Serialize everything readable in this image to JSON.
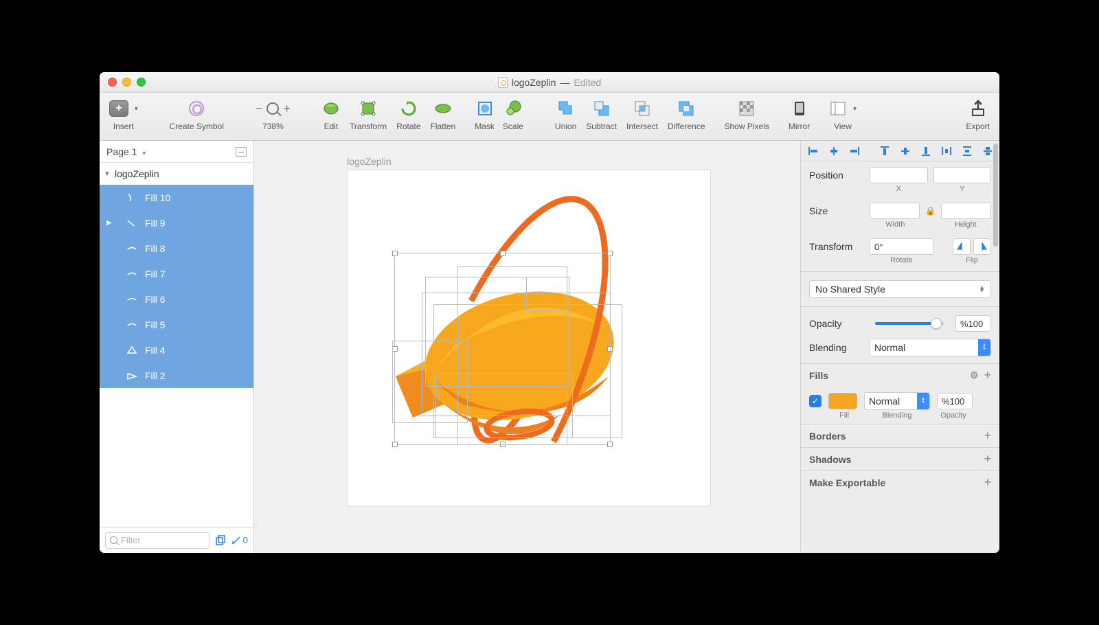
{
  "title": {
    "filename": "logoZeplin",
    "status": "Edited"
  },
  "toolbar": {
    "insert": "Insert",
    "create_symbol": "Create Symbol",
    "zoom": "738%",
    "edit": "Edit",
    "transform": "Transform",
    "rotate": "Rotate",
    "flatten": "Flatten",
    "mask": "Mask",
    "scale": "Scale",
    "union": "Union",
    "subtract": "Subtract",
    "intersect": "Intersect",
    "difference": "Difference",
    "show_pixels": "Show Pixels",
    "mirror": "Mirror",
    "view": "View",
    "export": "Export"
  },
  "left": {
    "page": "Page 1",
    "root": "logoZeplin",
    "layers": [
      "Fill 10",
      "Fill 9",
      "Fill 8",
      "Fill 7",
      "Fill 6",
      "Fill 5",
      "Fill 4",
      "Fill 2"
    ],
    "filter_placeholder": "Filter",
    "slice_count": "0"
  },
  "canvas": {
    "artboard_label": "logoZeplin"
  },
  "inspector": {
    "position_label": "Position",
    "x_label": "X",
    "y_label": "Y",
    "size_label": "Size",
    "width_label": "Width",
    "height_label": "Height",
    "transform_label": "Transform",
    "rotate_value": "0°",
    "rotate_label": "Rotate",
    "flip_label": "Flip",
    "shared_style": "No Shared Style",
    "opacity_label": "Opacity",
    "opacity_value": "%100",
    "blending_label": "Blending",
    "blending_mode": "Normal",
    "fills_header": "Fills",
    "fill_label": "Fill",
    "fill_blending_label": "Blending",
    "fill_blending_mode": "Normal",
    "fill_opacity_label": "Opacity",
    "fill_opacity_value": "%100",
    "fill_color": "#f5a623",
    "borders_header": "Borders",
    "shadows_header": "Shadows",
    "exportable_header": "Make Exportable"
  }
}
